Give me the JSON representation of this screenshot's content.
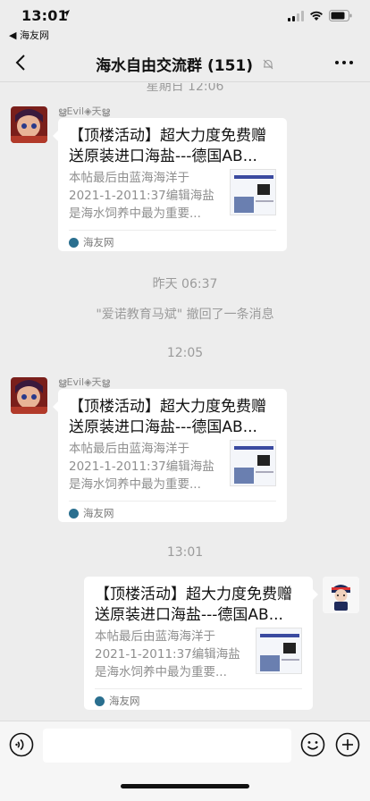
{
  "status_bar": {
    "time": "13:01",
    "back_app": "◀ 海友网"
  },
  "nav": {
    "title": "海水自由交流群 (151)",
    "back_icon": "chevron-left-icon",
    "more_icon": "ellipsis-icon",
    "mute_icon": "bell-slash-icon"
  },
  "chat": {
    "partial_time": "星期日 12:06",
    "messages": [
      {
        "sender": "ൠEvil◈天ൠ",
        "title": "【顶楼活动】超大力度免费赠送原装进口海盐---德国AB...",
        "desc": "本帖最后由蓝海海洋于2021-1-2011:37编辑海盐是海水饲养中最为重要...",
        "source": "海友网"
      },
      {
        "sender": "ൠEvil◈天ൠ",
        "title": "【顶楼活动】超大力度免费赠送原装进口海盐---德国AB...",
        "desc": "本帖最后由蓝海海洋于2021-1-2011:37编辑海盐是海水饲养中最为重要...",
        "source": "海友网"
      },
      {
        "title": "【顶楼活动】超大力度免费赠送原装进口海盐---德国AB...",
        "desc": "本帖最后由蓝海海洋于2021-1-2011:37编辑海盐是海水饲养中最为重要...",
        "source": "海友网"
      }
    ],
    "time_yesterday": "昨天 06:37",
    "recall_text": "\"爱诺教育马斌\" 撤回了一条消息",
    "time_1205": "12:05",
    "time_1301": "13:01"
  },
  "input_bar": {
    "placeholder": ""
  }
}
